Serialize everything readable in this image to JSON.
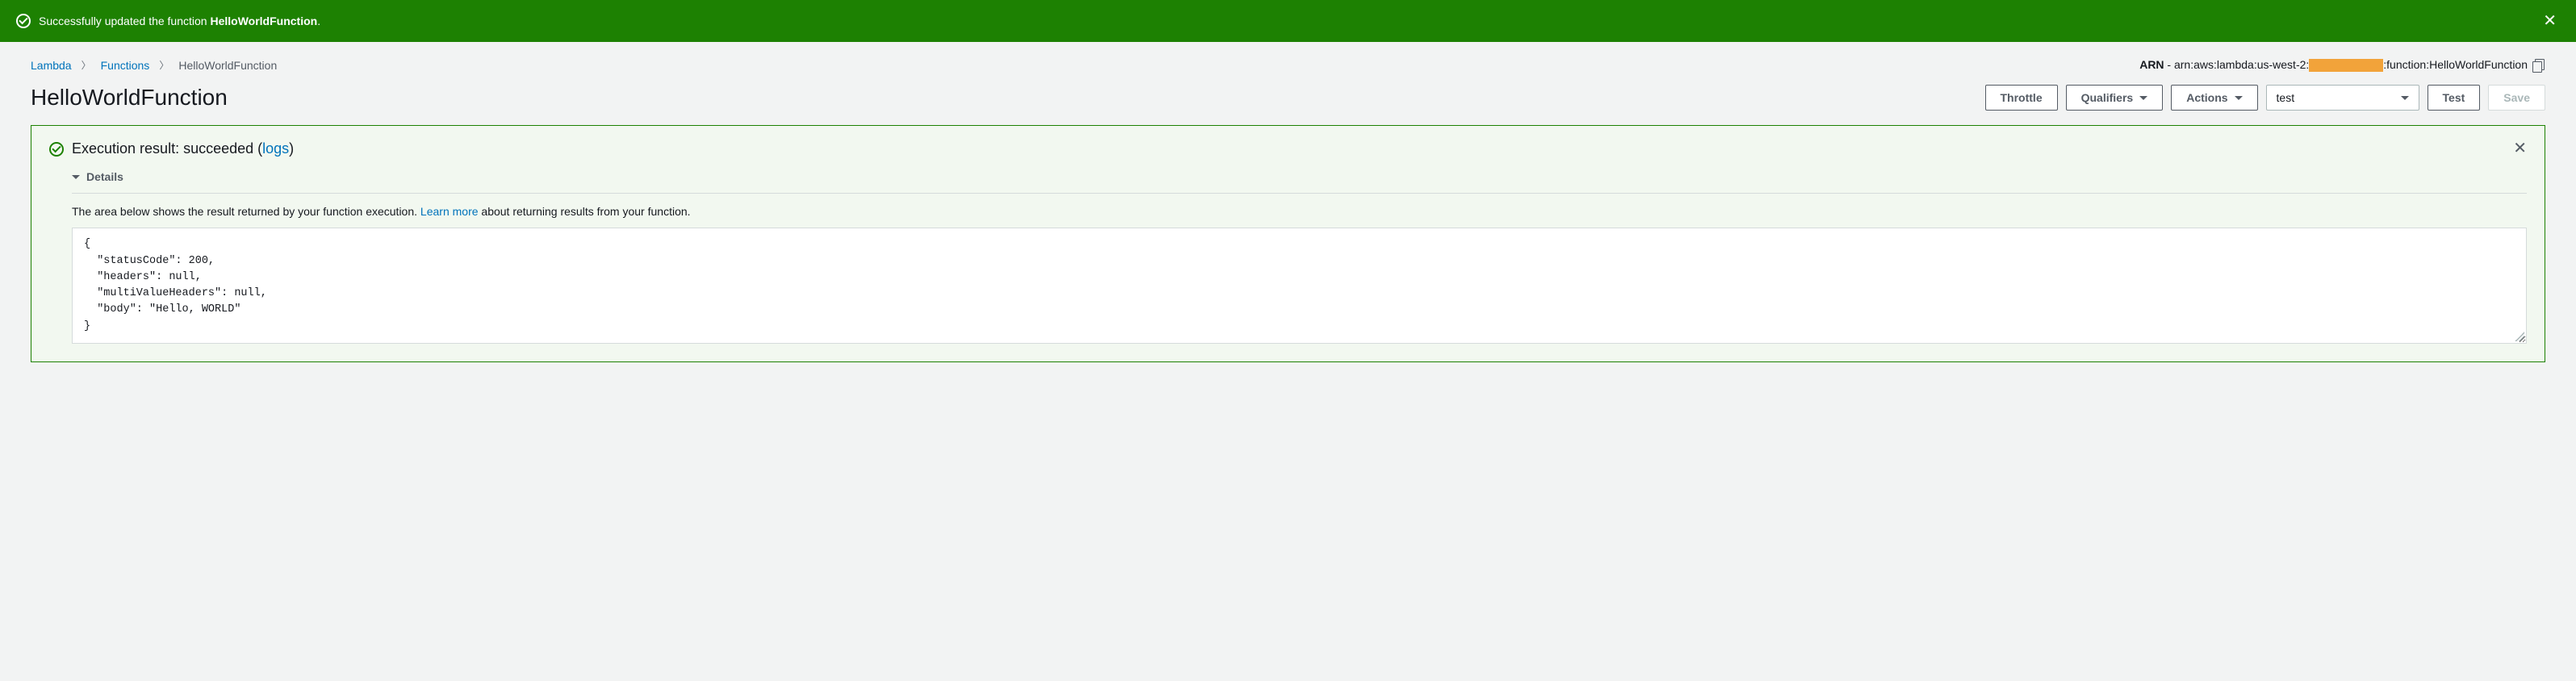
{
  "notification": {
    "prefix": "Successfully updated the function ",
    "function_name": "HelloWorldFunction",
    "suffix": "."
  },
  "breadcrumb": {
    "root": "Lambda",
    "level1": "Functions",
    "current": "HelloWorldFunction"
  },
  "arn": {
    "label": "ARN",
    "prefix": " - arn:aws:lambda:us-west-2:",
    "suffix": ":function:HelloWorldFunction"
  },
  "page_title": "HelloWorldFunction",
  "toolbar": {
    "throttle": "Throttle",
    "qualifiers": "Qualifiers",
    "actions": "Actions",
    "event_selected": "test",
    "test": "Test",
    "save": "Save"
  },
  "result": {
    "title_prefix": "Execution result: succeeded (",
    "logs_link": "logs",
    "title_suffix": ")",
    "details_label": "Details",
    "description_prefix": "The area below shows the result returned by your function execution. ",
    "learn_more": "Learn more",
    "description_suffix": " about returning results from your function.",
    "output": "{\n  \"statusCode\": 200,\n  \"headers\": null,\n  \"multiValueHeaders\": null,\n  \"body\": \"Hello, WORLD\"\n}"
  }
}
